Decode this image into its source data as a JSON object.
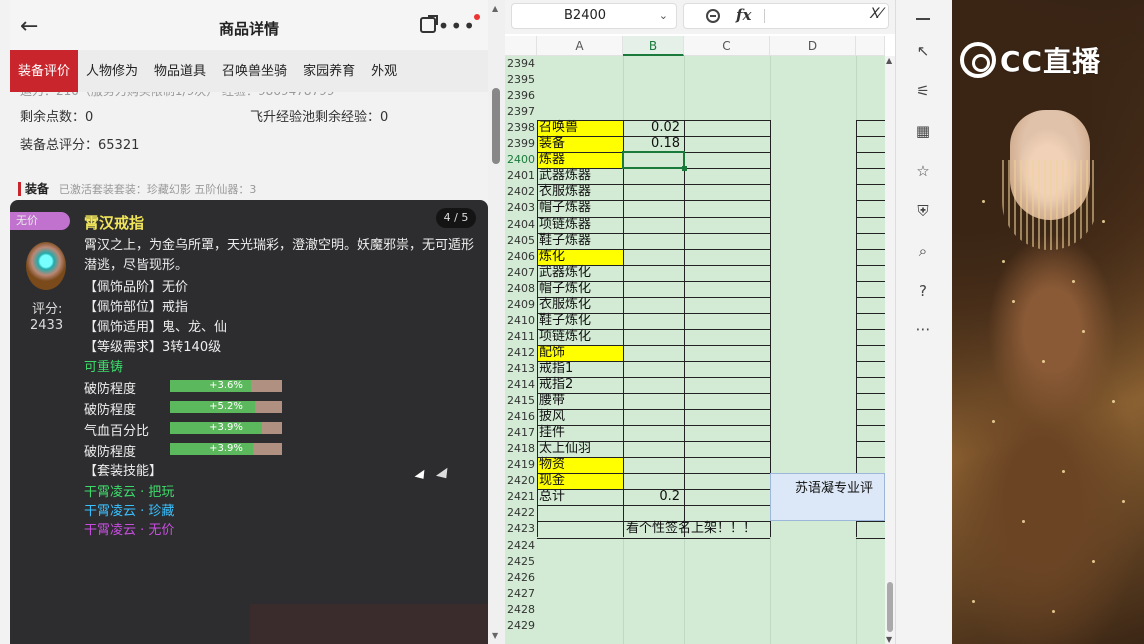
{
  "phone": {
    "title": "商品详情",
    "back_icon": "←",
    "more_icon": "•••",
    "tabs": [
      "装备评价",
      "人物修为",
      "物品道具",
      "召唤兽坐骑",
      "家园养育",
      "外观"
    ],
    "info": {
      "cut_line": "运力：210（服务力购买限制1/9次）        经验：9869478799",
      "remaining_points_label": "剩余点数：0",
      "feisheng_label": "飞升经验池剩余经验：0",
      "total_score_label": "装备总评分：65321",
      "equip_title": "装备",
      "equip_sub": "已激活套装套装：珍藏幻影  五阶仙器：3"
    },
    "item": {
      "rarity": "无价",
      "name": "霄汉戒指",
      "page": "4 / 5",
      "desc": "霄汉之上，为金乌所罩，天光瑞彩，澄澈空明。妖魔邪祟，无可遁形潜逃，尽皆现形。",
      "score_label": "评分:",
      "score": "2433",
      "attrs": [
        "【佩饰品阶】无价",
        "【佩饰部位】戒指",
        "【佩饰适用】鬼、龙、仙",
        "【等级需求】3转140级"
      ],
      "recast": "可重铸",
      "stats": [
        {
          "label": "破防程度",
          "pct_text": "+3.6%",
          "fill": 0.72
        },
        {
          "label": "破防程度",
          "pct_text": "+5.2%",
          "fill": 0.76
        },
        {
          "label": "气血百分比",
          "pct_text": "+3.9%",
          "fill": 0.82
        },
        {
          "label": "破防程度",
          "pct_text": "+3.9%",
          "fill": 0.74
        }
      ],
      "suit_title": "【套装技能】",
      "suit_skills": [
        {
          "text": "干霄凌云 · 把玩",
          "color": "#3ddc6a"
        },
        {
          "text": "干霄凌云 · 珍藏",
          "color": "#39c0ff"
        },
        {
          "text": "干霄凌云 · 无价",
          "color": "#c84de0"
        }
      ]
    }
  },
  "sheet": {
    "namebox": "B2400",
    "fx_label": "fx",
    "columns": [
      "A",
      "B",
      "C",
      "D"
    ],
    "rows": [
      {
        "n": "2394",
        "a": "",
        "b": ""
      },
      {
        "n": "2395",
        "a": "",
        "b": ""
      },
      {
        "n": "2396",
        "a": "",
        "b": ""
      },
      {
        "n": "2397",
        "a": "",
        "b": ""
      },
      {
        "n": "2398",
        "a": "召唤兽",
        "b": "0.02",
        "y": true
      },
      {
        "n": "2399",
        "a": "装备",
        "b": "0.18",
        "y": true
      },
      {
        "n": "2400",
        "a": "炼器",
        "b": "",
        "y": true
      },
      {
        "n": "2401",
        "a": "武器炼器",
        "b": ""
      },
      {
        "n": "2402",
        "a": "衣服炼器",
        "b": ""
      },
      {
        "n": "2403",
        "a": "帽子炼器",
        "b": ""
      },
      {
        "n": "2404",
        "a": "项链炼器",
        "b": ""
      },
      {
        "n": "2405",
        "a": "鞋子炼器",
        "b": ""
      },
      {
        "n": "2406",
        "a": "炼化",
        "b": "",
        "y": true
      },
      {
        "n": "2407",
        "a": "武器炼化",
        "b": ""
      },
      {
        "n": "2408",
        "a": "帽子炼化",
        "b": ""
      },
      {
        "n": "2409",
        "a": "衣服炼化",
        "b": ""
      },
      {
        "n": "2410",
        "a": "鞋子炼化",
        "b": ""
      },
      {
        "n": "2411",
        "a": "项链炼化",
        "b": ""
      },
      {
        "n": "2412",
        "a": "配饰",
        "b": "",
        "y": true
      },
      {
        "n": "2413",
        "a": "戒指1",
        "b": ""
      },
      {
        "n": "2414",
        "a": "戒指2",
        "b": ""
      },
      {
        "n": "2415",
        "a": "腰带",
        "b": ""
      },
      {
        "n": "2416",
        "a": "披风",
        "b": ""
      },
      {
        "n": "2417",
        "a": "挂件",
        "b": ""
      },
      {
        "n": "2418",
        "a": "太上仙羽",
        "b": ""
      },
      {
        "n": "2419",
        "a": "物资",
        "b": "",
        "y": true
      },
      {
        "n": "2420",
        "a": "现金",
        "b": "",
        "y": true
      },
      {
        "n": "2421",
        "a": "总计",
        "b": "0.2"
      },
      {
        "n": "2422",
        "a": "",
        "b": ""
      },
      {
        "n": "2423",
        "a": "",
        "b": ""
      },
      {
        "n": "2424",
        "a": "",
        "b": ""
      },
      {
        "n": "2425",
        "a": "",
        "b": ""
      },
      {
        "n": "2426",
        "a": "",
        "b": ""
      },
      {
        "n": "2427",
        "a": "",
        "b": ""
      },
      {
        "n": "2428",
        "a": "",
        "b": ""
      },
      {
        "n": "2429",
        "a": "",
        "b": ""
      }
    ],
    "note_2423": "看个性签名上架！！！",
    "blue_cell": "苏语凝专业评"
  },
  "stream": {
    "logo_text": "CC直播"
  }
}
